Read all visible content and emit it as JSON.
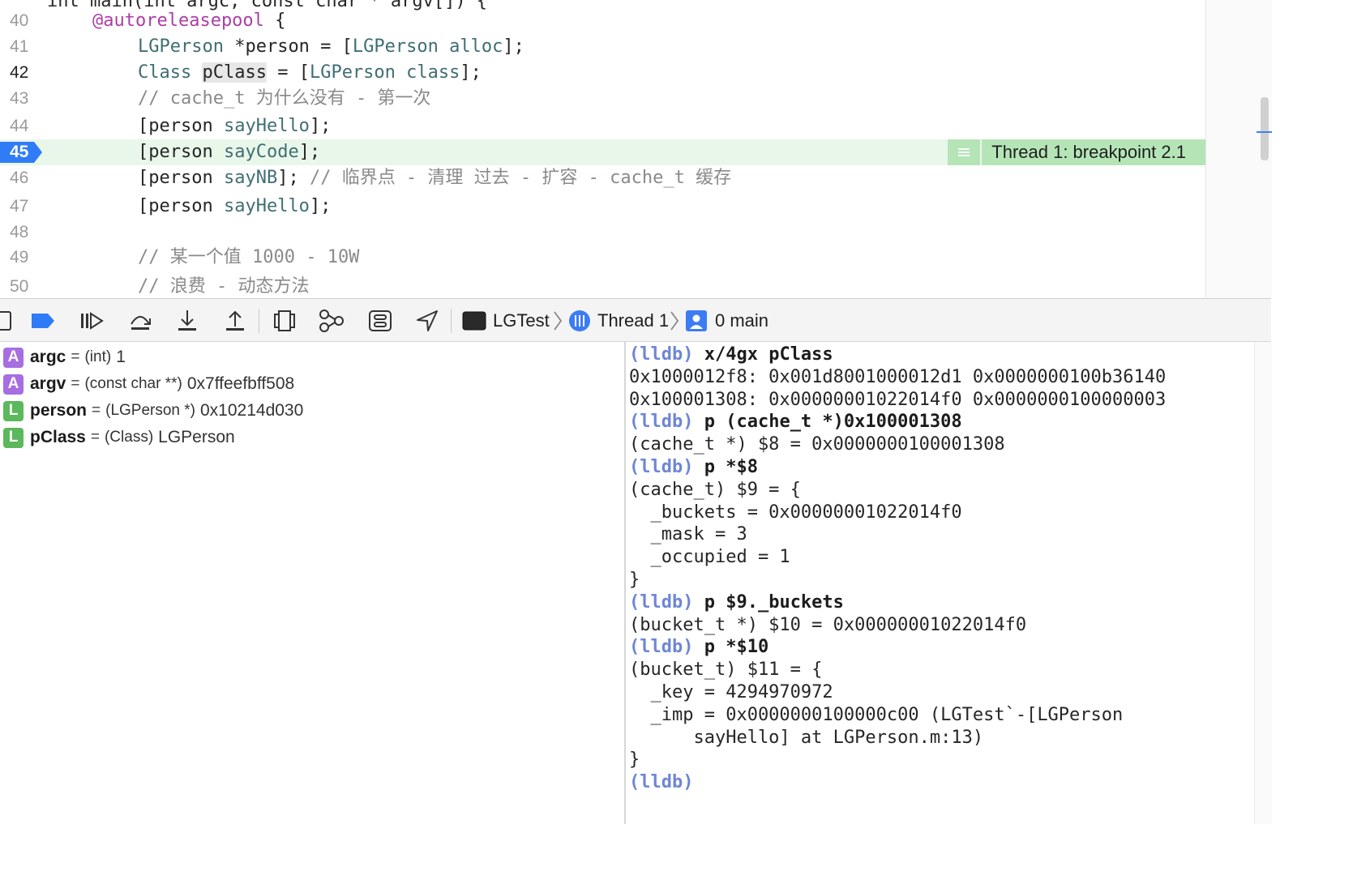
{
  "editor": {
    "top_line_partial": "int main(int argc, const char * argv[]) {",
    "lines": [
      {
        "num": "40",
        "indent": 1,
        "parts": [
          {
            "t": "@autoreleasepool",
            "c": "kw-mag"
          },
          {
            "t": " {",
            "c": ""
          }
        ]
      },
      {
        "num": "41",
        "indent": 2,
        "parts": [
          {
            "t": "LGPerson",
            "c": "typ"
          },
          {
            "t": " *person = [",
            "c": ""
          },
          {
            "t": "LGPerson",
            "c": "typ"
          },
          {
            "t": " ",
            "c": ""
          },
          {
            "t": "alloc",
            "c": "msg"
          },
          {
            "t": "];",
            "c": ""
          }
        ]
      },
      {
        "num": "42",
        "indent": 2,
        "current": true,
        "parts": [
          {
            "t": "Class",
            "c": "typ"
          },
          {
            "t": " ",
            "c": ""
          },
          {
            "t": "pClass",
            "c": "hl-word"
          },
          {
            "t": " = [",
            "c": ""
          },
          {
            "t": "LGPerson",
            "c": "typ"
          },
          {
            "t": " ",
            "c": ""
          },
          {
            "t": "class",
            "c": "msg"
          },
          {
            "t": "];",
            "c": ""
          }
        ]
      },
      {
        "num": "43",
        "indent": 2,
        "parts": [
          {
            "t": "// cache_t 为什么没有 - 第一次",
            "c": "cmt"
          }
        ]
      },
      {
        "num": "44",
        "indent": 2,
        "parts": [
          {
            "t": "[person ",
            "c": ""
          },
          {
            "t": "sayHello",
            "c": "msg"
          },
          {
            "t": "];",
            "c": ""
          }
        ]
      },
      {
        "num": "45",
        "indent": 2,
        "breakpoint": true,
        "parts": [
          {
            "t": "[person ",
            "c": ""
          },
          {
            "t": "sayCode",
            "c": "msg"
          },
          {
            "t": "];",
            "c": ""
          }
        ]
      },
      {
        "num": "46",
        "indent": 2,
        "parts": [
          {
            "t": "[person ",
            "c": ""
          },
          {
            "t": "sayNB",
            "c": "msg"
          },
          {
            "t": "]; ",
            "c": ""
          },
          {
            "t": "// 临界点 - 清理 过去 - 扩容 - cache_t 缓存",
            "c": "cmt"
          }
        ]
      },
      {
        "num": "47",
        "indent": 2,
        "parts": [
          {
            "t": "[person ",
            "c": ""
          },
          {
            "t": "sayHello",
            "c": "msg"
          },
          {
            "t": "];",
            "c": ""
          }
        ]
      },
      {
        "num": "48",
        "indent": 2,
        "parts": []
      },
      {
        "num": "49",
        "indent": 2,
        "parts": [
          {
            "t": "// 某一个值 1000 - 10W",
            "c": "cmt"
          }
        ]
      },
      {
        "num": "50",
        "indent": 2,
        "parts": [
          {
            "t": "// 浪费 - 动态方法",
            "c": "cmt"
          }
        ]
      }
    ],
    "breakpoint_label": "Thread 1: breakpoint 2.1"
  },
  "debugbar": {
    "process": "LGTest",
    "thread": "Thread 1",
    "frame": "0 main",
    "icons": [
      "sidebar-toggle-icon",
      "breakpoints-toggle-icon",
      "continue-icon",
      "step-over-icon",
      "step-into-icon",
      "step-out-icon",
      "view-hierarchy-icon",
      "memory-graph-icon",
      "environment-overrides-icon",
      "simulate-location-icon"
    ]
  },
  "variables": [
    {
      "badge": "A",
      "name": "argc",
      "eq": "=",
      "type": "(int)",
      "value": "1"
    },
    {
      "badge": "A",
      "name": "argv",
      "eq": "=",
      "type": "(const char **)",
      "value": "0x7ffeefbff508"
    },
    {
      "badge": "L",
      "name": "person",
      "eq": "=",
      "type": "(LGPerson *)",
      "value": "0x10214d030"
    },
    {
      "badge": "L",
      "name": "pClass",
      "eq": "=",
      "type": "(Class)",
      "value": "LGPerson"
    }
  ],
  "console": {
    "lines": [
      {
        "prompt": "(lldb)",
        "cmd": " x/4gx pClass"
      },
      {
        "text": "0x1000012f8: 0x001d8001000012d1 0x0000000100b36140"
      },
      {
        "text": "0x100001308: 0x00000001022014f0 0x0000000100000003"
      },
      {
        "prompt": "(lldb)",
        "cmd": " p (cache_t *)0x100001308"
      },
      {
        "text": "(cache_t *) $8 = 0x0000000100001308"
      },
      {
        "prompt": "(lldb)",
        "cmd": " p *$8"
      },
      {
        "text": "(cache_t) $9 = {"
      },
      {
        "text": "  _buckets = 0x00000001022014f0"
      },
      {
        "text": "  _mask = 3"
      },
      {
        "text": "  _occupied = 1"
      },
      {
        "text": "}"
      },
      {
        "prompt": "(lldb)",
        "cmd": " p $9._buckets"
      },
      {
        "text": "(bucket_t *) $10 = 0x00000001022014f0"
      },
      {
        "prompt": "(lldb)",
        "cmd": " p *$10"
      },
      {
        "text": "(bucket_t) $11 = {"
      },
      {
        "text": "  _key = 4294970972"
      },
      {
        "text": "  _imp = 0x0000000100000c00 (LGTest`-[LGPerson"
      },
      {
        "text": "      sayHello] at LGPerson.m:13)"
      },
      {
        "text": "}"
      },
      {
        "prompt": "(lldb)",
        "cmd": ""
      }
    ]
  }
}
